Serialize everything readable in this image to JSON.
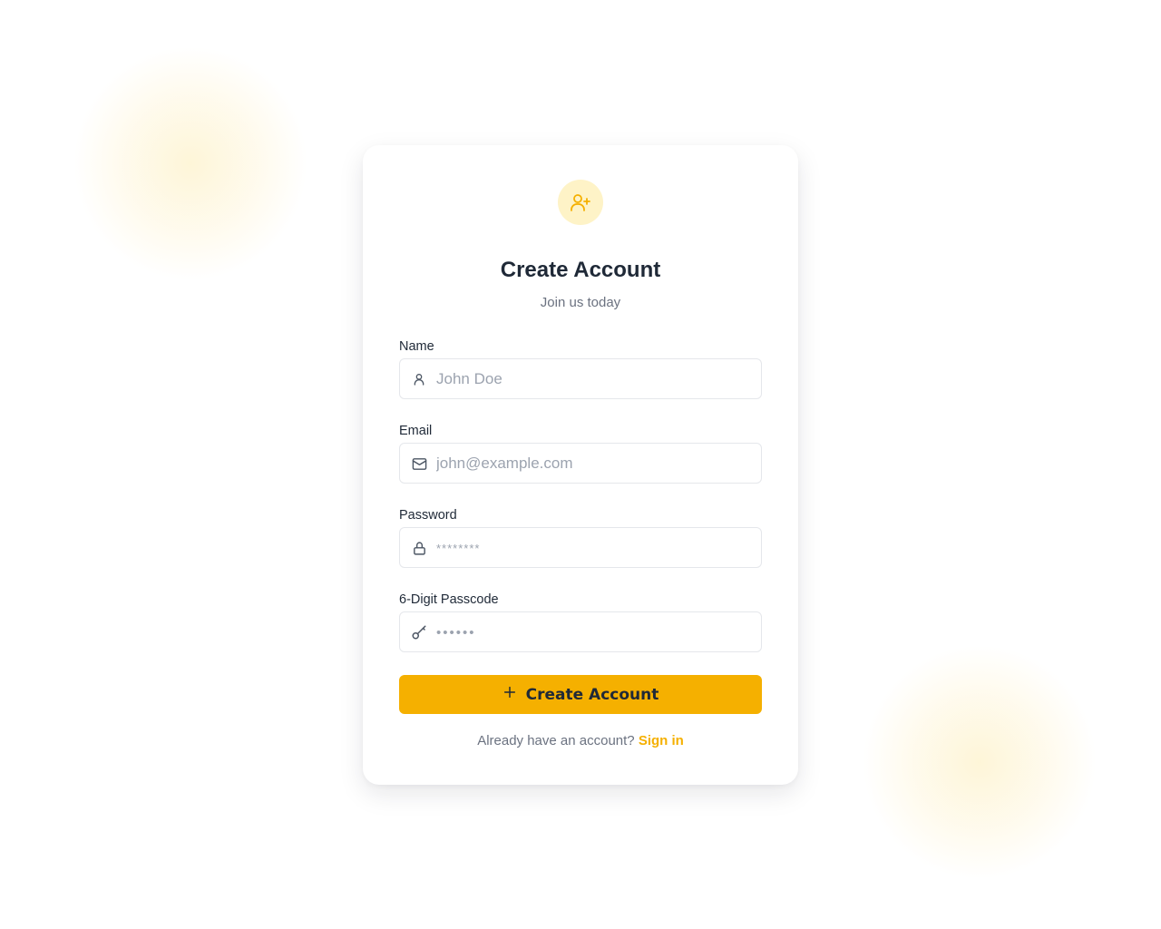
{
  "header": {
    "title": "Create Account",
    "subtitle": "Join us today"
  },
  "fields": [
    {
      "label": "Name",
      "placeholder": "John Doe",
      "icon": "user-icon"
    },
    {
      "label": "Email",
      "placeholder": "john@example.com",
      "icon": "mail-icon"
    },
    {
      "label": "Password",
      "placeholder": "********",
      "icon": "lock-icon"
    },
    {
      "label": "6-Digit Passcode",
      "placeholder": "••••••",
      "icon": "key-icon"
    }
  ],
  "submit": {
    "label": "Create Account",
    "icon": "plus-icon"
  },
  "footer": {
    "prompt": "Already have an account?",
    "link": "Sign in"
  },
  "badge_icon": "user-plus-icon",
  "colors": {
    "accent": "#f5b000",
    "badge_bg": "#fef3c7",
    "text": "#1f2937",
    "muted": "#6b7280"
  }
}
